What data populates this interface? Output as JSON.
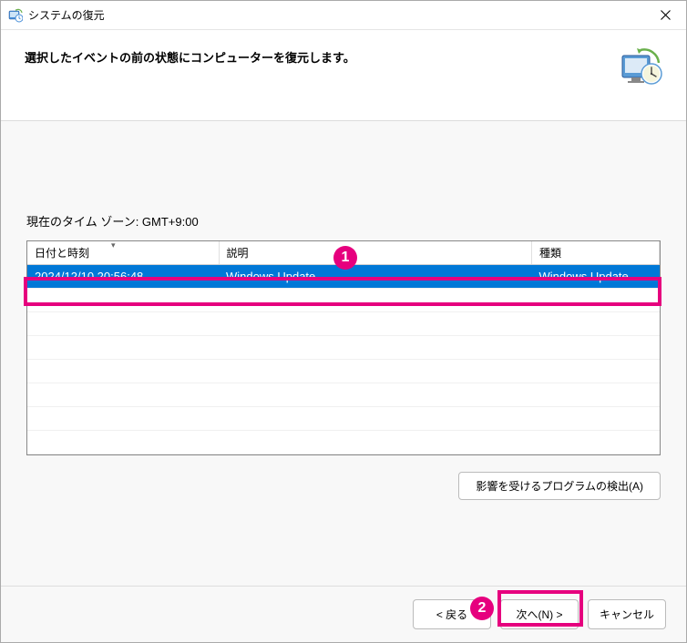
{
  "window": {
    "title": "システムの復元"
  },
  "header": {
    "instruction": "選択したイベントの前の状態にコンピューターを復元します。"
  },
  "content": {
    "timezone_label": "現在のタイム ゾーン: GMT+9:00",
    "columns": {
      "date": "日付と時刻",
      "description": "説明",
      "type": "種類"
    },
    "rows": [
      {
        "date": "2024/12/10 20:56:48",
        "description": "Windows Update",
        "type": "Windows Update"
      }
    ],
    "detect_button": "影響を受けるプログラムの検出(A)"
  },
  "footer": {
    "back": "< 戻る",
    "next": "次へ(N) >",
    "cancel": "キャンセル"
  },
  "annotations": {
    "badge1": "1",
    "badge2": "2"
  }
}
